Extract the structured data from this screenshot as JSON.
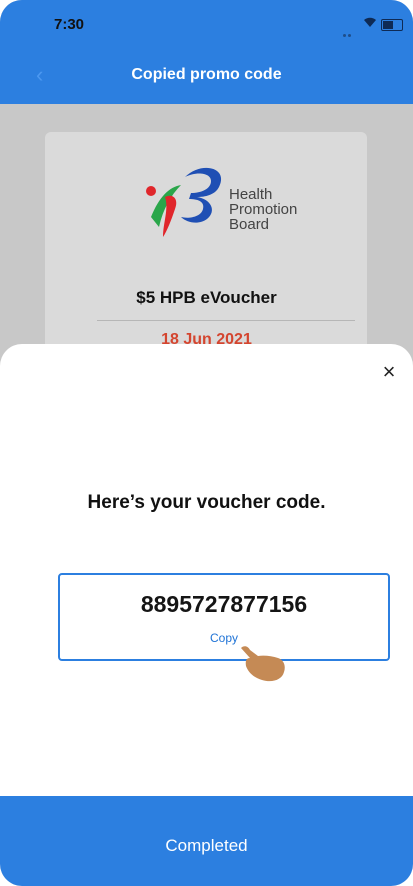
{
  "status_bar": {
    "time": "7:30"
  },
  "nav": {
    "title": "Copied promo code"
  },
  "background_card": {
    "logo_text": [
      "Health",
      "Promotion",
      "Board"
    ],
    "voucher_title": "$5 HPB eVoucher",
    "date": "18 Jun 2021"
  },
  "sheet": {
    "heading": "Here’s your voucher code.",
    "code": "8895727877156",
    "copy_label": "Copy",
    "close_symbol": "×"
  },
  "footer": {
    "completed_label": "Completed"
  },
  "colors": {
    "accent": "#2c7fe0",
    "date_red": "#d4452f",
    "logo_red": "#e0262b",
    "logo_green": "#2aa64a",
    "logo_blue": "#1f4fb4"
  },
  "icons": [
    "wifi-icon",
    "battery-icon",
    "back-icon",
    "close-icon",
    "hand-pointer-icon",
    "hpb-logo"
  ]
}
